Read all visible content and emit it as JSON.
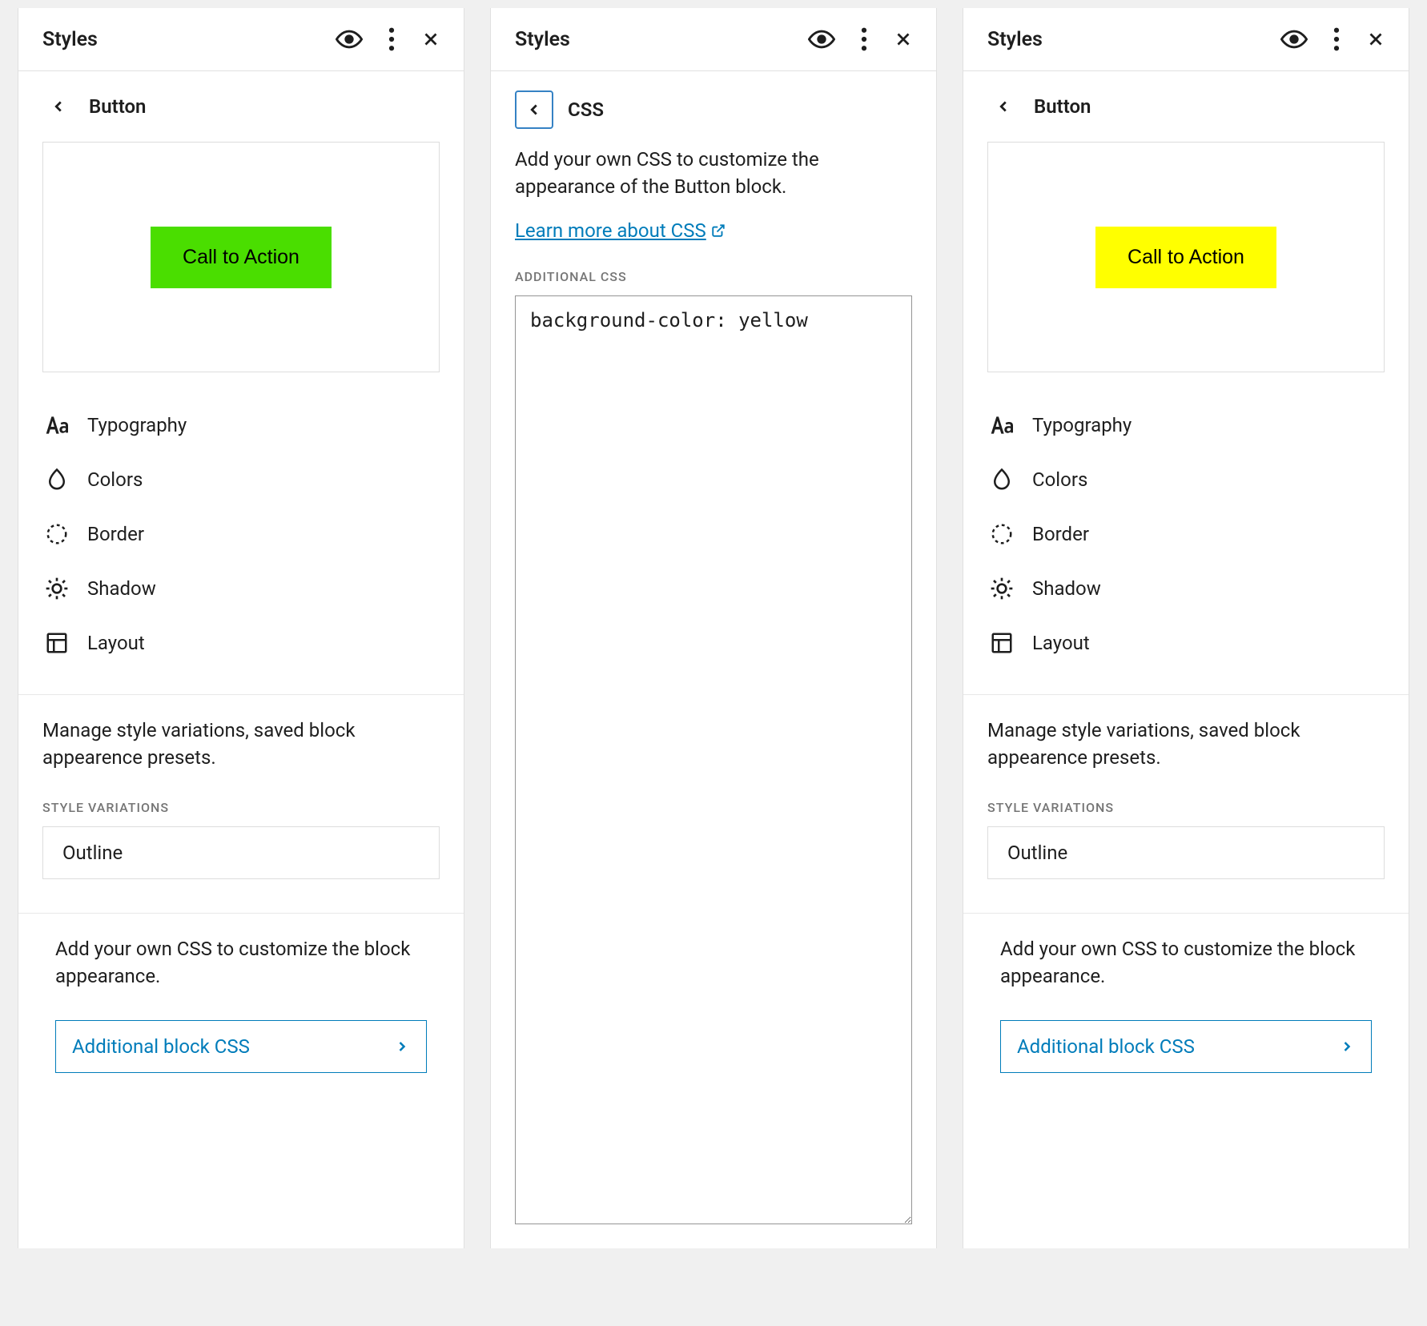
{
  "panels": {
    "left": {
      "title": "Styles",
      "subtitle": "Button",
      "preview_label": "Call to Action",
      "preview_color": "#4ade00",
      "items": [
        "Typography",
        "Colors",
        "Border",
        "Shadow",
        "Layout"
      ],
      "variations_desc": "Manage style variations, saved block appearence presets.",
      "variations_heading": "STYLE VARIATIONS",
      "variation_option": "Outline",
      "css_desc": "Add your own CSS to customize the block appearance.",
      "css_nav_label": "Additional block CSS"
    },
    "center": {
      "title": "Styles",
      "subtitle": "CSS",
      "desc": "Add your own CSS to customize the appearance of the Button block.",
      "learn_link": "Learn more about CSS",
      "css_heading": "ADDITIONAL CSS",
      "css_value": "background-color: yellow"
    },
    "right": {
      "title": "Styles",
      "subtitle": "Button",
      "preview_label": "Call to Action",
      "preview_color": "#ffff00",
      "items": [
        "Typography",
        "Colors",
        "Border",
        "Shadow",
        "Layout"
      ],
      "variations_desc": "Manage style variations, saved block appearence presets.",
      "variations_heading": "STYLE VARIATIONS",
      "variation_option": "Outline",
      "css_desc": "Add your own CSS to customize the block appearance.",
      "css_nav_label": "Additional block CSS"
    }
  }
}
